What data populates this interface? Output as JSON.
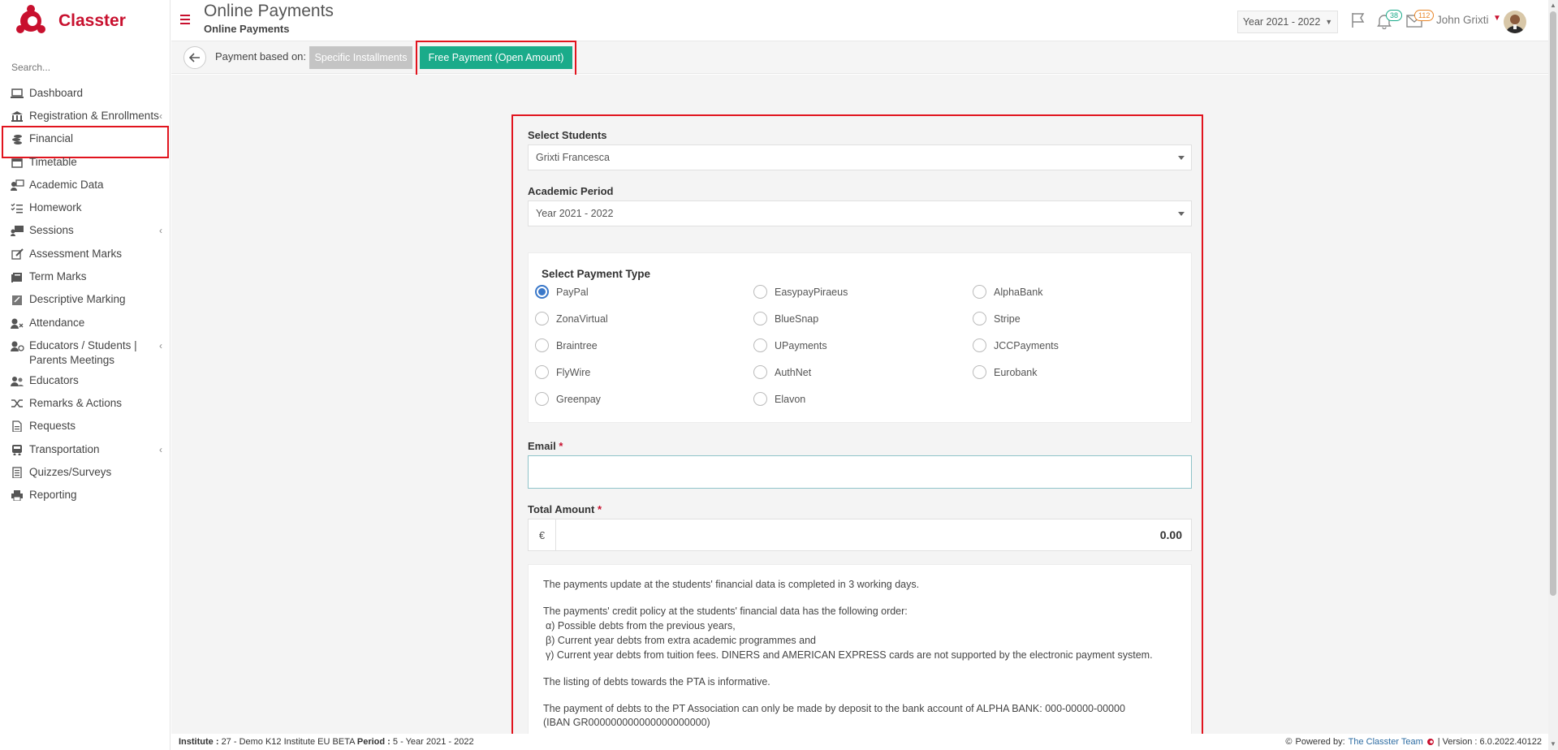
{
  "app": {
    "name": "Classter"
  },
  "search": {
    "placeholder": "Search..."
  },
  "sidebar": {
    "items": [
      {
        "label": "Dashboard",
        "icon": "laptop-icon",
        "chevron": false
      },
      {
        "label": "Registration & Enrollments",
        "icon": "institution-icon",
        "chevron": true
      },
      {
        "label": "Financial",
        "icon": "coins-icon",
        "chevron": false,
        "highlighted": true
      },
      {
        "label": "Timetable",
        "icon": "calendar-icon",
        "chevron": false
      },
      {
        "label": "Academic Data",
        "icon": "user-board-icon",
        "chevron": false
      },
      {
        "label": "Homework",
        "icon": "checklist-icon",
        "chevron": false
      },
      {
        "label": "Sessions",
        "icon": "sessions-icon",
        "chevron": true
      },
      {
        "label": "Assessment Marks",
        "icon": "edit-icon",
        "chevron": false
      },
      {
        "label": "Term Marks",
        "icon": "book-icon",
        "chevron": false
      },
      {
        "label": "Descriptive Marking",
        "icon": "marking-icon",
        "chevron": false
      },
      {
        "label": "Attendance",
        "icon": "user-x-icon",
        "chevron": false
      },
      {
        "label": "Educators / Students | Parents Meetings",
        "icon": "meeting-icon",
        "chevron": true
      },
      {
        "label": "Educators",
        "icon": "users-icon",
        "chevron": false
      },
      {
        "label": "Remarks & Actions",
        "icon": "shuffle-icon",
        "chevron": false
      },
      {
        "label": "Requests",
        "icon": "file-icon",
        "chevron": false
      },
      {
        "label": "Transportation",
        "icon": "bus-icon",
        "chevron": true
      },
      {
        "label": "Quizzes/Surveys",
        "icon": "list-icon",
        "chevron": false
      },
      {
        "label": "Reporting",
        "icon": "printer-icon",
        "chevron": false
      }
    ]
  },
  "header": {
    "title": "Online Payments",
    "subtitle": "Online Payments",
    "year": "Year 2021 - 2022",
    "notifications_count": "38",
    "messages_count": "112",
    "user_name": "John Grixti"
  },
  "toolbar": {
    "based_on_label": "Payment based on:",
    "specific_label": "Specific Installments",
    "free_label": "Free Payment (Open Amount)"
  },
  "form": {
    "students_label": "Select Students",
    "students_value": "Grixti Francesca",
    "period_label": "Academic Period",
    "period_value": "Year 2021 - 2022",
    "payment_type_label": "Select Payment Type",
    "payment_types": [
      [
        "PayPal",
        "EasypayPiraeus",
        "AlphaBank"
      ],
      [
        "ZonaVirtual",
        "BlueSnap",
        "Stripe"
      ],
      [
        "Braintree",
        "UPayments",
        "JCCPayments"
      ],
      [
        "FlyWire",
        "AuthNet",
        "Eurobank"
      ],
      [
        "Greenpay",
        "Elavon"
      ]
    ],
    "selected_payment_type": "PayPal",
    "email_label": "Email",
    "email_value": "",
    "amount_label": "Total Amount",
    "currency": "€",
    "amount_value": "0.00",
    "required_mark": "*"
  },
  "info": {
    "p1": "The payments update at the students' financial data is completed in 3 working days.",
    "p2_intro": "The payments' credit policy at the students' financial data has the following order:",
    "p2_items": [
      "α) Possible debts from the previous years,",
      "β) Current year debts from extra academic programmes and",
      "γ) Current year debts from tuition fees. DINERS and AMERICAN EXPRESS cards are not supported by the electronic payment system."
    ],
    "p3": "The listing of debts towards the PTA is informative.",
    "p4": "The payment of debts to the PT Association can only be made by deposit to the bank account of ALPHA BANK: 000-00000-00000",
    "p5": "(IBAN GR000000000000000000000)"
  },
  "footer": {
    "institute_label": "Institute :",
    "institute_value": "27 - Demo K12 Institute EU BETA",
    "period_label": "Period :",
    "period_value": "5 - Year 2021 - 2022",
    "powered_label": "Powered by:",
    "powered_link": "The Classter Team",
    "version_label": "| Version : 6.0.2022.40122"
  },
  "colors": {
    "brand": "#c8102e",
    "accent_green": "#1aab8a",
    "highlight_red": "#e1141e",
    "radio_blue": "#3a78c9"
  }
}
